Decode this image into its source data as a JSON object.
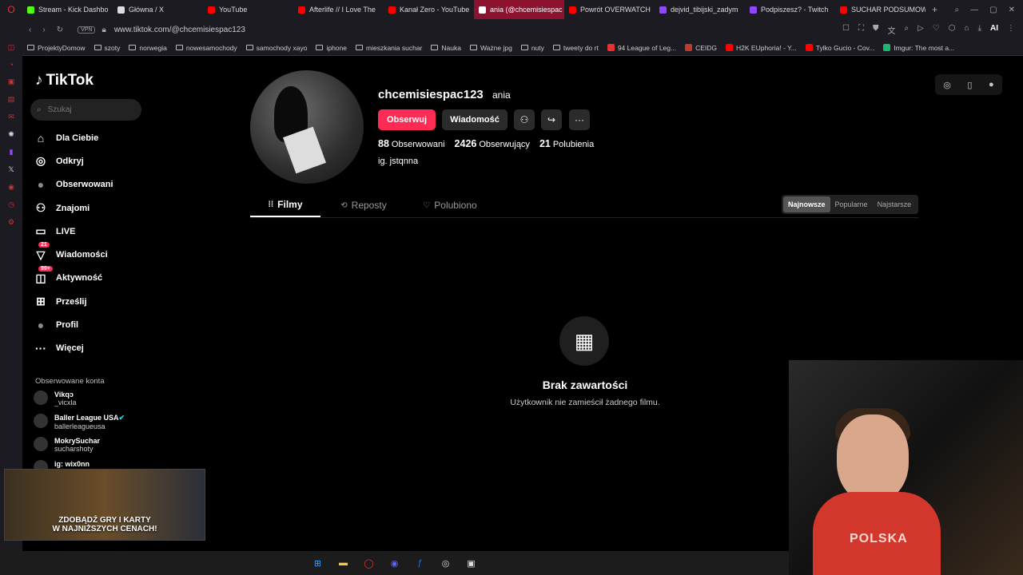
{
  "browser": {
    "tabs": [
      {
        "label": "Stream - Kick Dashbo",
        "color": "#53fc18"
      },
      {
        "label": "Główna / X",
        "color": "#dddddd"
      },
      {
        "label": "YouTube",
        "color": "#ff0000"
      },
      {
        "label": "Afterlife // I Love The",
        "color": "#ff0000"
      },
      {
        "label": "Kanał Zero - YouTube",
        "color": "#ff0000"
      },
      {
        "label": "ania (@chcemisiespac",
        "color": "#ffffff",
        "active": true
      },
      {
        "label": "Powrót OVERWATCH",
        "color": "#ff0000"
      },
      {
        "label": "dejvid_tibijski_zadym",
        "color": "#9146ff"
      },
      {
        "label": "Podpiszesz? - Twitch",
        "color": "#9146ff"
      },
      {
        "label": "SUCHAR PODSUMOW",
        "color": "#ff0000"
      }
    ],
    "new_tab": "+",
    "vpn": "VPN",
    "url": "www.tiktok.com/@chcemisiespac123",
    "ai_label": "AI",
    "bookmarks": [
      {
        "label": "ProjektyDomow",
        "type": "folder"
      },
      {
        "label": "szoty",
        "type": "folder"
      },
      {
        "label": "norwegia",
        "type": "folder"
      },
      {
        "label": "nowesamochody",
        "type": "folder"
      },
      {
        "label": "samochody xayo",
        "type": "folder"
      },
      {
        "label": "iphone",
        "type": "folder"
      },
      {
        "label": "mieszkania suchar",
        "type": "folder"
      },
      {
        "label": "Nauka",
        "type": "folder"
      },
      {
        "label": "Ważne jpg",
        "type": "folder"
      },
      {
        "label": "nuty",
        "type": "folder"
      },
      {
        "label": "tweety do rt",
        "type": "folder"
      },
      {
        "label": "94 League of Leg...",
        "type": "site",
        "color": "#e8322e"
      },
      {
        "label": "CEIDG",
        "type": "site",
        "color": "#c0392b"
      },
      {
        "label": "H2K EUphoria! - Y...",
        "type": "site",
        "color": "#ff0000"
      },
      {
        "label": "Tylko Gucio - Cov...",
        "type": "site",
        "color": "#ff0000"
      },
      {
        "label": "Imgur: The most a...",
        "type": "site",
        "color": "#1bb76e"
      }
    ]
  },
  "tiktok": {
    "logo_text": "TikTok",
    "search_placeholder": "Szukaj",
    "nav": [
      {
        "label": "Dla Ciebie",
        "icon": "home-icon",
        "glyph": "⌂"
      },
      {
        "label": "Odkryj",
        "icon": "compass-icon",
        "glyph": "◎"
      },
      {
        "label": "Obserwowani",
        "icon": "following-avatar-icon",
        "glyph": "●"
      },
      {
        "label": "Znajomi",
        "icon": "friends-icon",
        "glyph": "⚇"
      },
      {
        "label": "LIVE",
        "icon": "live-icon",
        "glyph": "▭"
      },
      {
        "label": "Wiadomości",
        "icon": "inbox-icon",
        "glyph": "▽",
        "badge": "21"
      },
      {
        "label": "Aktywność",
        "icon": "activity-icon",
        "glyph": "◫",
        "badge": "99+"
      },
      {
        "label": "Prześlij",
        "icon": "upload-icon",
        "glyph": "⊞"
      },
      {
        "label": "Profil",
        "icon": "profile-icon",
        "glyph": "●"
      },
      {
        "label": "Więcej",
        "icon": "more-icon",
        "glyph": "···"
      }
    ],
    "following_header": "Obserwowane konta",
    "following": [
      {
        "name": "Vikqɔ",
        "handle": "_vicxla"
      },
      {
        "name": "Baller League USA",
        "handle": "ballerleagueusa",
        "verified": true
      },
      {
        "name": "MokrySuchar",
        "handle": "sucharshoty"
      },
      {
        "name": "ig: wix0nn",
        "handle": ""
      }
    ],
    "promo": {
      "line1": "ZDOBĄDŹ GRY I KARTY",
      "line2": "W NAJNIŻSZYCH CENACH!"
    },
    "profile": {
      "username": "chcemisiespac123",
      "display_name": "ania",
      "follow_btn": "Obserwuj",
      "message_btn": "Wiadomość",
      "stats": [
        {
          "value": "88",
          "label": "Obserwowani"
        },
        {
          "value": "2426",
          "label": "Obserwujący"
        },
        {
          "value": "21",
          "label": "Polubienia"
        }
      ],
      "bio": "ig. jstqnna"
    },
    "tabs": [
      {
        "label": "Filmy",
        "glyph": "⁞⁞",
        "active": true
      },
      {
        "label": "Reposty",
        "glyph": "⟲"
      },
      {
        "label": "Polubiono",
        "glyph": "♡"
      }
    ],
    "sort": [
      {
        "label": "Najnowsze",
        "active": true
      },
      {
        "label": "Popularne"
      },
      {
        "label": "Najstarsze"
      }
    ],
    "empty": {
      "title": "Brak zawartości",
      "subtitle": "Użytkownik nie zamieścił żadnego filmu."
    }
  },
  "webcam": {
    "shirt_text": "POLSKA"
  }
}
